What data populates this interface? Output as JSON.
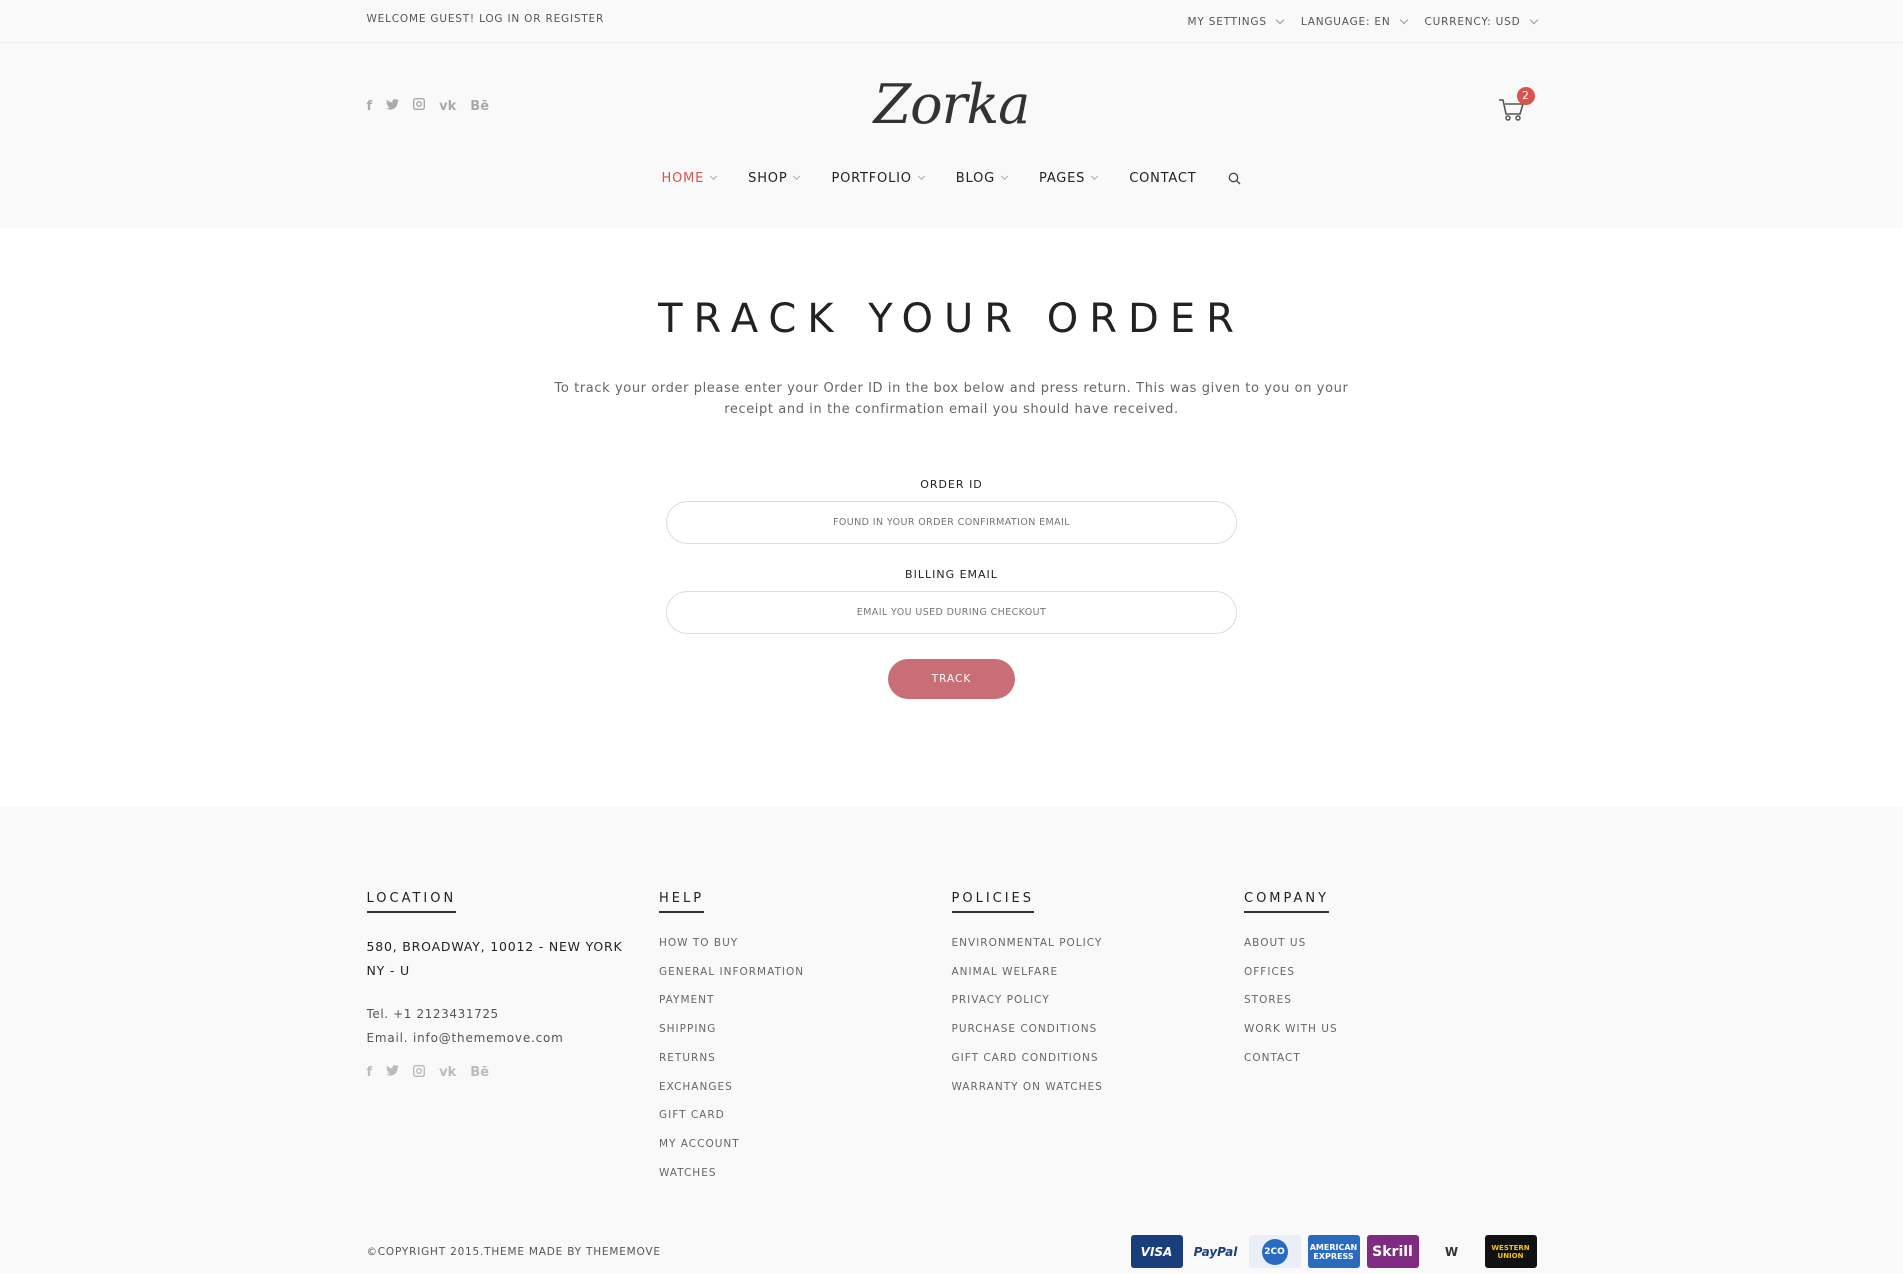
{
  "topbar": {
    "welcome": "WELCOME GUEST! LOG IN OR REGISTER",
    "my_settings": "MY SETTINGS",
    "language": "LANGUAGE: EN",
    "currency": "CURRENCY: USD"
  },
  "header": {
    "logo": "Zorka",
    "cart_count": "2",
    "social": [
      "f",
      "t",
      "ig",
      "vk",
      "Bē"
    ]
  },
  "nav": {
    "home": "HOME",
    "shop": "SHOP",
    "portfolio": "PORTFOLIO",
    "blog": "BLOG",
    "pages": "PAGES",
    "contact": "CONTACT"
  },
  "main": {
    "title": "TRACK YOUR ORDER",
    "intro": "To track your order please enter your Order ID in the box below and press return. This was given to you on your receipt and in the confirmation email you should have received.",
    "order_label": "ORDER ID",
    "order_placeholder": "FOUND IN YOUR ORDER CONFIRMATION EMAIL",
    "email_label": "BILLING EMAIL",
    "email_placeholder": "EMAIL YOU USED DURING CHECKOUT",
    "track_label": "TRACK"
  },
  "footer": {
    "location": {
      "heading": "LOCATION",
      "address": "580, BROADWAY, 10012 - NEW YORK NY - U",
      "tel": "Tel. +1 2123431725",
      "email": "Email. info@thememove.com"
    },
    "help": {
      "heading": "HELP",
      "items": [
        "HOW TO BUY",
        "GENERAL INFORMATION",
        "PAYMENT",
        "SHIPPING",
        "RETURNS",
        "EXCHANGES",
        "GIFT CARD",
        "MY ACCOUNT",
        "WATCHES"
      ]
    },
    "policies": {
      "heading": "POLICIES",
      "items": [
        "ENVIRONMENTAL POLICY",
        "ANIMAL WELFARE",
        "PRIVACY POLICY",
        "PURCHASE CONDITIONS",
        "GIFT CARD CONDITIONS",
        "WARRANTY ON WATCHES"
      ]
    },
    "company": {
      "heading": "COMPANY",
      "items": [
        "ABOUT US",
        "OFFICES",
        "STORES",
        "WORK WITH US",
        "CONTACT"
      ]
    },
    "copyright": "©COPYRIGHT 2015.THEME MADE BY THEMEMOVE",
    "payments": {
      "visa": "VISA",
      "paypal": "PayPal",
      "tco": "2CO",
      "amex": "AMERICAN EXPRESS",
      "skrill": "Skrill",
      "gw": "W",
      "wu": "WESTERN UNION"
    }
  }
}
